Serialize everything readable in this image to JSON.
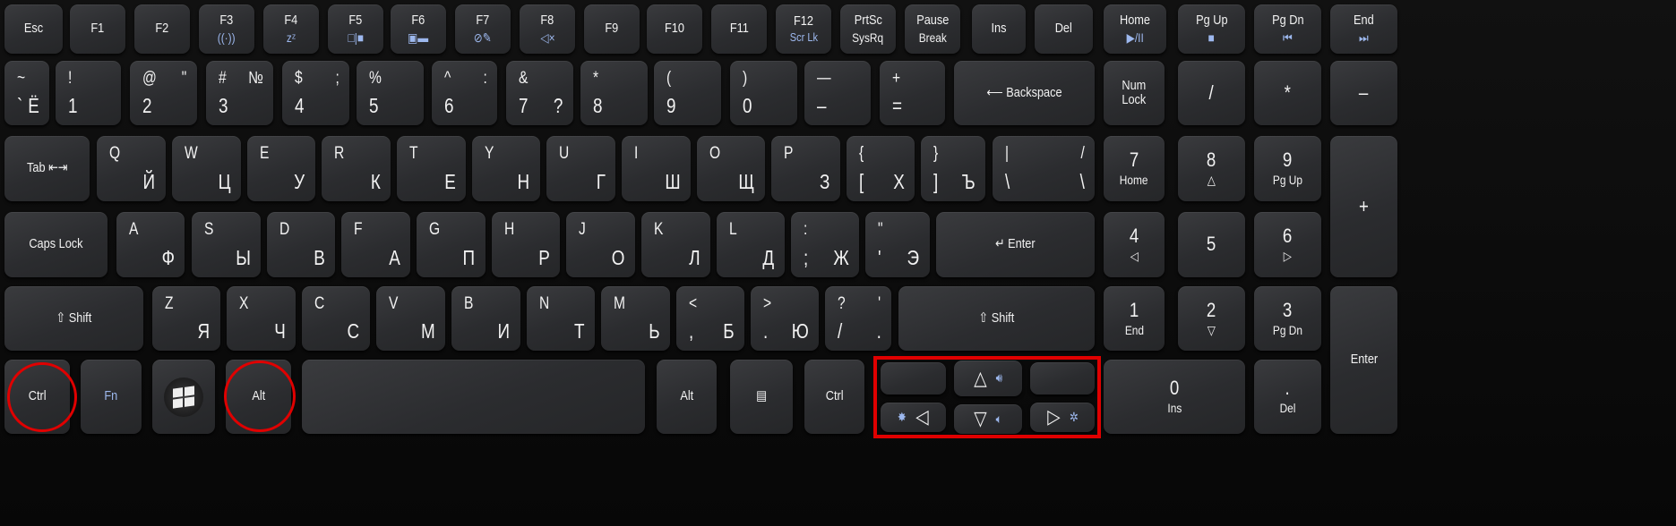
{
  "annotation_color": "#e00000",
  "label_colors": {
    "primary": "#f2f2f2",
    "secondary": "#9db8ee"
  },
  "function_row": [
    {
      "c": "Esc"
    },
    {
      "c": "F1"
    },
    {
      "c": "F2"
    },
    {
      "c": "F3",
      "icon": "wireless-icon",
      "sub": "((·))"
    },
    {
      "c": "F4",
      "icon": "sleep-icon",
      "sub": "zᶻ"
    },
    {
      "c": "F5",
      "icon": "display-switch-icon",
      "sub": "□|■"
    },
    {
      "c": "F6",
      "icon": "screen-off-icon",
      "sub": "▣▬"
    },
    {
      "c": "F7",
      "icon": "touchpad-toggle-icon",
      "sub": "⊘✎"
    },
    {
      "c": "F8",
      "icon": "mute-icon",
      "sub": "◁×"
    },
    {
      "c": "F9"
    },
    {
      "c": "F10"
    },
    {
      "c": "F11"
    },
    {
      "c": "F12",
      "sub": "Scr Lk"
    },
    {
      "c": "PrtSc",
      "sub": "SysRq",
      "sub_style": "white"
    },
    {
      "c": "Pause",
      "sub": "Break",
      "sub_style": "white"
    },
    {
      "c": "Ins"
    },
    {
      "c": "Del"
    },
    {
      "c": "Home",
      "icon": "play-pause-icon",
      "sub": "▶/II"
    },
    {
      "c": "Pg Up",
      "icon": "stop-icon",
      "sub": "■"
    },
    {
      "c": "Pg Dn",
      "icon": "previous-track-icon",
      "sub": "⏮"
    },
    {
      "c": "End",
      "icon": "next-track-icon",
      "sub": "⏭"
    }
  ],
  "number_row": [
    {
      "tl": "~",
      "bl": "`",
      "br": "Ё"
    },
    {
      "tl": "!",
      "bl": "1"
    },
    {
      "tl": "@",
      "tr": "\"",
      "bl": "2"
    },
    {
      "tl": "#",
      "tr": "№",
      "bl": "3"
    },
    {
      "tl": "$",
      "tr": ";",
      "bl": "4"
    },
    {
      "tl": "%",
      "bl": "5"
    },
    {
      "tl": "^",
      "tr": ":",
      "bl": "6"
    },
    {
      "tl": "&",
      "bl": "7",
      "br": "?"
    },
    {
      "tl": "*",
      "bl": "8"
    },
    {
      "tl": "(",
      "bl": "9"
    },
    {
      "tl": ")",
      "bl": "0"
    },
    {
      "tl": "—",
      "bl": "–"
    },
    {
      "tl": "+",
      "bl": "="
    },
    {
      "c": "⟵ Backspace"
    }
  ],
  "top_row": [
    {
      "c": "Tab ⇤⇥"
    },
    {
      "tl": "Q",
      "br": "Й"
    },
    {
      "tl": "W",
      "br": "Ц"
    },
    {
      "tl": "E",
      "br": "У"
    },
    {
      "tl": "R",
      "br": "К"
    },
    {
      "tl": "T",
      "br": "Е"
    },
    {
      "tl": "Y",
      "br": "Н"
    },
    {
      "tl": "U",
      "br": "Г"
    },
    {
      "tl": "I",
      "br": "Ш"
    },
    {
      "tl": "O",
      "br": "Щ"
    },
    {
      "tl": "P",
      "br": "З"
    },
    {
      "tl": "{",
      "bl": "[",
      "br": "Х"
    },
    {
      "tl": "}",
      "bl": "]",
      "br": "Ъ"
    },
    {
      "tl": "|",
      "tr": "/",
      "bl": "\\",
      "br": "\\"
    }
  ],
  "home_row": [
    {
      "c": "Caps Lock"
    },
    {
      "tl": "A",
      "br": "Ф"
    },
    {
      "tl": "S",
      "br": "Ы"
    },
    {
      "tl": "D",
      "br": "В"
    },
    {
      "tl": "F",
      "br": "А"
    },
    {
      "tl": "G",
      "br": "П"
    },
    {
      "tl": "H",
      "br": "Р"
    },
    {
      "tl": "J",
      "br": "О"
    },
    {
      "tl": "K",
      "br": "Л"
    },
    {
      "tl": "L",
      "br": "Д"
    },
    {
      "tl": ":",
      "bl": ";",
      "br": "Ж"
    },
    {
      "tl": "\"",
      "bl": "'",
      "br": "Э"
    },
    {
      "c": "↵ Enter"
    }
  ],
  "bottom_row": [
    {
      "c": "⇧ Shift"
    },
    {
      "tl": "Z",
      "br": "Я"
    },
    {
      "tl": "X",
      "br": "Ч"
    },
    {
      "tl": "C",
      "br": "С"
    },
    {
      "tl": "V",
      "br": "М"
    },
    {
      "tl": "B",
      "br": "И"
    },
    {
      "tl": "N",
      "br": "Т"
    },
    {
      "tl": "M",
      "br": "Ь"
    },
    {
      "tl": "<",
      "bl": ",",
      "br": "Б"
    },
    {
      "tl": ">",
      "bl": ".",
      "br": "Ю"
    },
    {
      "tl": "?",
      "tr": "'",
      "bl": "/",
      "br": "."
    },
    {
      "c": "⇧ Shift"
    }
  ],
  "modifier_row": [
    {
      "c": "Ctrl",
      "annotated": true
    },
    {
      "c": "Fn",
      "label_color": "#9db8ee"
    },
    {
      "c": "",
      "icon": "windows-logo-icon"
    },
    {
      "c": "Alt",
      "annotated": true
    },
    {
      "c": ""
    },
    {
      "c": "Alt"
    },
    {
      "c": "▤",
      "icon": "context-menu-icon"
    },
    {
      "c": "Ctrl"
    }
  ],
  "arrow_cluster": [
    {
      "c": ""
    },
    {
      "c": "△",
      "icon": "volume-up-icon",
      "sub": "🔊︎"
    },
    {
      "c": ""
    },
    {
      "c": "◁",
      "icon": "brightness-down-icon",
      "sub": "✸"
    },
    {
      "c": "▽",
      "icon": "volume-down-icon",
      "sub": "🔈︎"
    },
    {
      "c": "▷",
      "icon": "brightness-up-icon",
      "sub": "✲"
    }
  ],
  "numpad": [
    {
      "c": "Num\nLock"
    },
    {
      "c": "/"
    },
    {
      "c": "*"
    },
    {
      "c": "–"
    },
    {
      "c": "7",
      "sub": "Home",
      "sub_style": "white"
    },
    {
      "c": "8",
      "sub": "△",
      "sub_style": "white"
    },
    {
      "c": "9",
      "sub": "Pg Up",
      "sub_style": "white"
    },
    {
      "c": "+"
    },
    {
      "c": "4",
      "sub": "◁",
      "sub_style": "white"
    },
    {
      "c": "5"
    },
    {
      "c": "6",
      "sub": "▷",
      "sub_style": "white"
    },
    {
      "c": "1",
      "sub": "End",
      "sub_style": "white"
    },
    {
      "c": "2",
      "sub": "▽",
      "sub_style": "white"
    },
    {
      "c": "3",
      "sub": "Pg Dn",
      "sub_style": "white"
    },
    {
      "c": "Enter"
    },
    {
      "c": "0",
      "sub": "Ins",
      "sub_style": "white"
    },
    {
      "c": ".",
      "sub": "Del",
      "sub_style": "white"
    }
  ]
}
